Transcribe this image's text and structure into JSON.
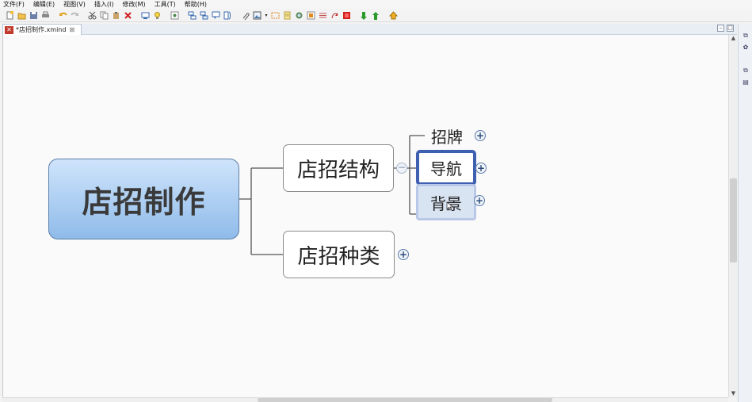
{
  "menu": {
    "items": [
      "文件(F)",
      "编辑(E)",
      "视图(V)",
      "插入(I)",
      "修改(M)",
      "工具(T)",
      "帮助(H)"
    ]
  },
  "toolbar": {
    "icons": [
      "new-file-icon",
      "open-folder-icon",
      "save-icon",
      "print-icon",
      "undo-icon",
      "redo-icon",
      "cut-icon",
      "copy-icon",
      "paste-icon",
      "delete-icon",
      "topic-icon",
      "idea-icon",
      "brainstorm-icon",
      "subtopic-icon",
      "floating-topic-icon",
      "callout-icon",
      "summary-icon",
      "attachment-icon",
      "image-icon",
      "boundary-icon",
      "note-icon",
      "marker-icon",
      "label-icon",
      "relationship-icon",
      "stop-icon",
      "drill-down-icon",
      "drill-up-icon",
      "home-icon"
    ]
  },
  "editor": {
    "tab_title": "*店招制作.xmind"
  },
  "mindmap": {
    "central": "店招制作",
    "branches": [
      {
        "label": "店招结构",
        "children": [
          "招牌",
          "导航",
          "背景"
        ]
      },
      {
        "label": "店招种类",
        "children": []
      }
    ],
    "expand_symbol": "+",
    "collapse_symbol": "−"
  },
  "colors": {
    "central_fill_top": "#cfe4fb",
    "central_fill_bottom": "#8fbbea",
    "selection_border": "#3f5fb0",
    "secondary_selection": "#d9e4f3"
  }
}
